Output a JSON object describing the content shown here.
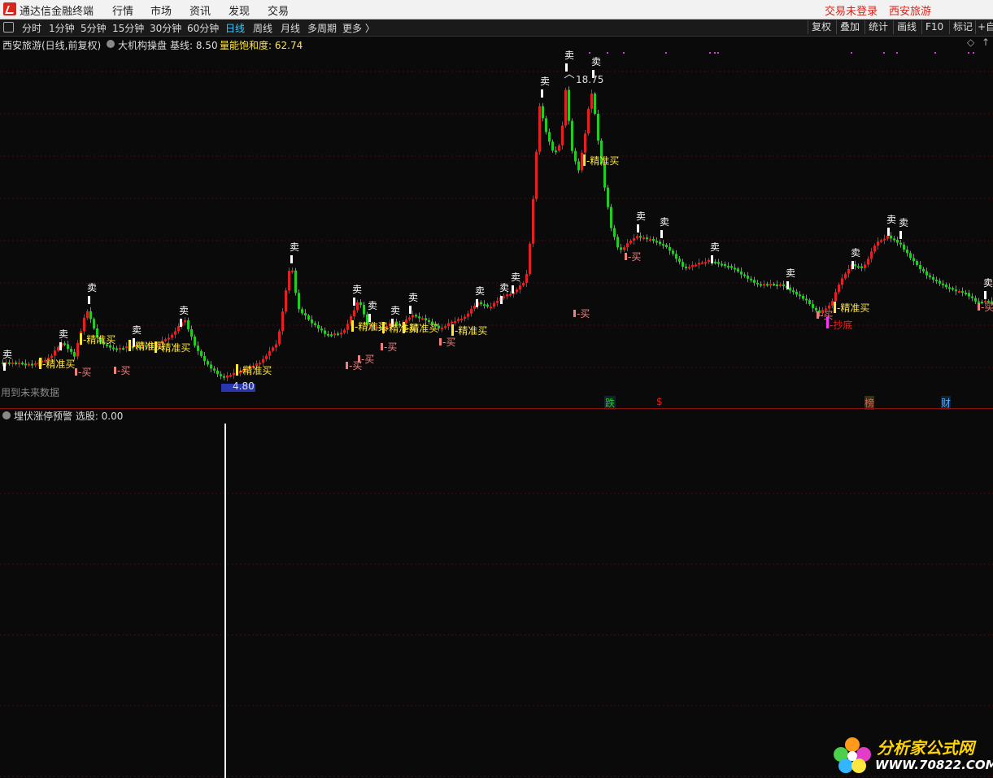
{
  "window": {
    "app_name": "通达信金融终端",
    "menu": [
      "行情",
      "市场",
      "资讯",
      "发现",
      "交易"
    ],
    "login_status": "交易未登录",
    "stock_title": "西安旅游"
  },
  "toolbar": {
    "periods": [
      "分时",
      "1分钟",
      "5分钟",
      "15分钟",
      "30分钟",
      "60分钟",
      "日线",
      "周线",
      "月线",
      "多周期",
      "更多 〉"
    ],
    "active_period": "日线",
    "right_buttons": [
      "复权",
      "叠加",
      "统计",
      "画线",
      "F10",
      "标记",
      "+自"
    ]
  },
  "main_panel": {
    "stock_label": "西安旅游(日线,前复权)",
    "indicator_name": "大机构操盘",
    "baseline_label": "基线: 8.50",
    "saturation_label": "量能饱和度: 62.74",
    "future_data_note": "用到未来数据",
    "high_price": "18.75",
    "low_price": "4.80",
    "signal_sell": "卖",
    "signal_buy": "-买",
    "signal_precise_buy": "-精准买",
    "signal_bottom": "-抄底",
    "events": [
      "跌",
      "$",
      "榜",
      "财"
    ]
  },
  "sub_panel": {
    "indicator_label": "埋伏涨停预警 选股: 0.00"
  },
  "colors": {
    "up": "#e52020",
    "down": "#22cc22",
    "signal_yellow": "#ffe640",
    "sell_white": "#ffffff",
    "buy_pink": "#f08080",
    "grid": "#4a0c0c"
  },
  "watermark": {
    "title": "分析家公式网",
    "url": "WWW.70822.COM"
  }
}
